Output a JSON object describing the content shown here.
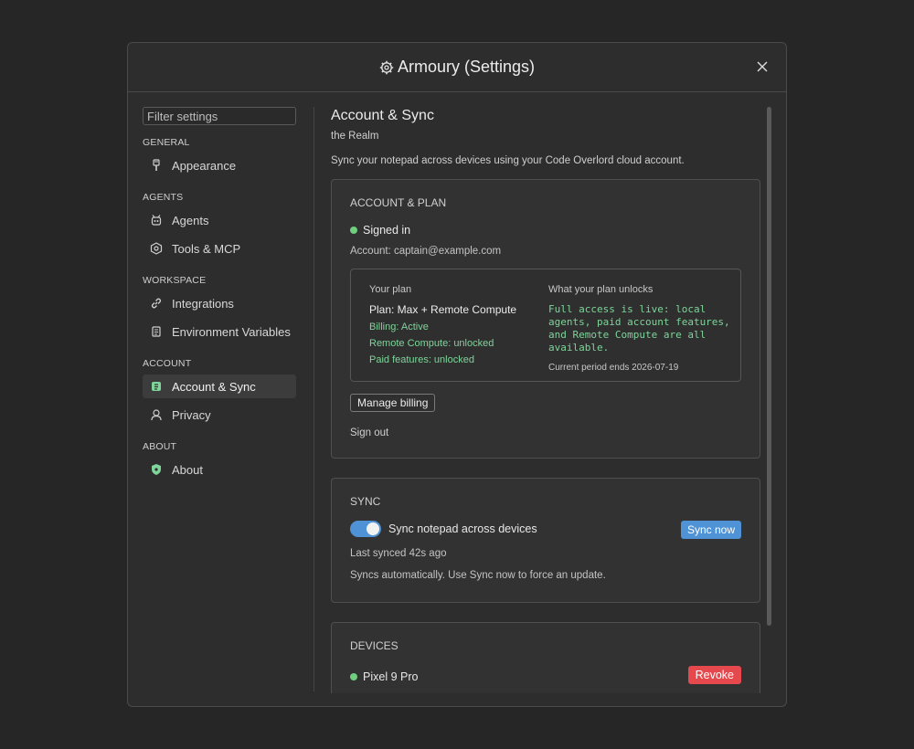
{
  "dialog": {
    "title": "Armoury (Settings)",
    "gear_icon": "gear-icon",
    "close_icon": "close-icon"
  },
  "sidebar": {
    "filter_placeholder": "Filter settings",
    "groups": [
      {
        "title": "General",
        "items": [
          {
            "label": "Appearance",
            "icon": "brush-icon"
          }
        ]
      },
      {
        "title": "Agents",
        "items": [
          {
            "label": "Agents",
            "icon": "robot-icon"
          },
          {
            "label": "Tools & MCP",
            "icon": "tools-icon"
          }
        ]
      },
      {
        "title": "Workspace",
        "items": [
          {
            "label": "Integrations",
            "icon": "link-icon"
          },
          {
            "label": "Environment Variables",
            "icon": "scroll-icon"
          }
        ]
      },
      {
        "title": "Account",
        "items": [
          {
            "label": "Account & Sync",
            "icon": "sync-icon",
            "active": true
          },
          {
            "label": "Privacy",
            "icon": "person-icon"
          }
        ]
      },
      {
        "title": "About",
        "items": [
          {
            "label": "About",
            "icon": "shield-icon"
          }
        ]
      }
    ]
  },
  "main": {
    "title": "Account & Sync",
    "subtitle": "the Realm",
    "description": "Sync your notepad across devices using your Code Overlord cloud account.",
    "account_card": {
      "title": "Account & Plan",
      "status": "Signed in",
      "status_color": "#6fcf7f",
      "account": "Account: captain@example.com",
      "plan": {
        "your_plan_label": "Your plan",
        "plan_name": "Plan: Max + Remote Compute",
        "billing": "Billing: Active",
        "remote_compute": "Remote Compute: unlocked",
        "paid_features": "Paid features: unlocked",
        "unlocks_label": "What your plan unlocks",
        "unlocks_text": "Full access is live: local agents, paid account features, and Remote Compute are all available.",
        "period": "Current period ends 2026-07-19"
      },
      "manage_billing": "Manage billing",
      "sign_out": "Sign out"
    },
    "sync_card": {
      "title": "Sync",
      "toggle_label": "Sync notepad across devices",
      "toggle_on": true,
      "sync_now": "Sync now",
      "last_synced": "Last synced 42s ago",
      "note": "Syncs automatically. Use Sync now to force an update."
    },
    "devices_card": {
      "title": "Devices",
      "devices": [
        {
          "name": "Pixel 9 Pro",
          "revoke": "Revoke"
        }
      ]
    }
  },
  "colors": {
    "accent_blue": "#4f93d6",
    "danger_red": "#e5484d",
    "success_green": "#7ed49a"
  }
}
